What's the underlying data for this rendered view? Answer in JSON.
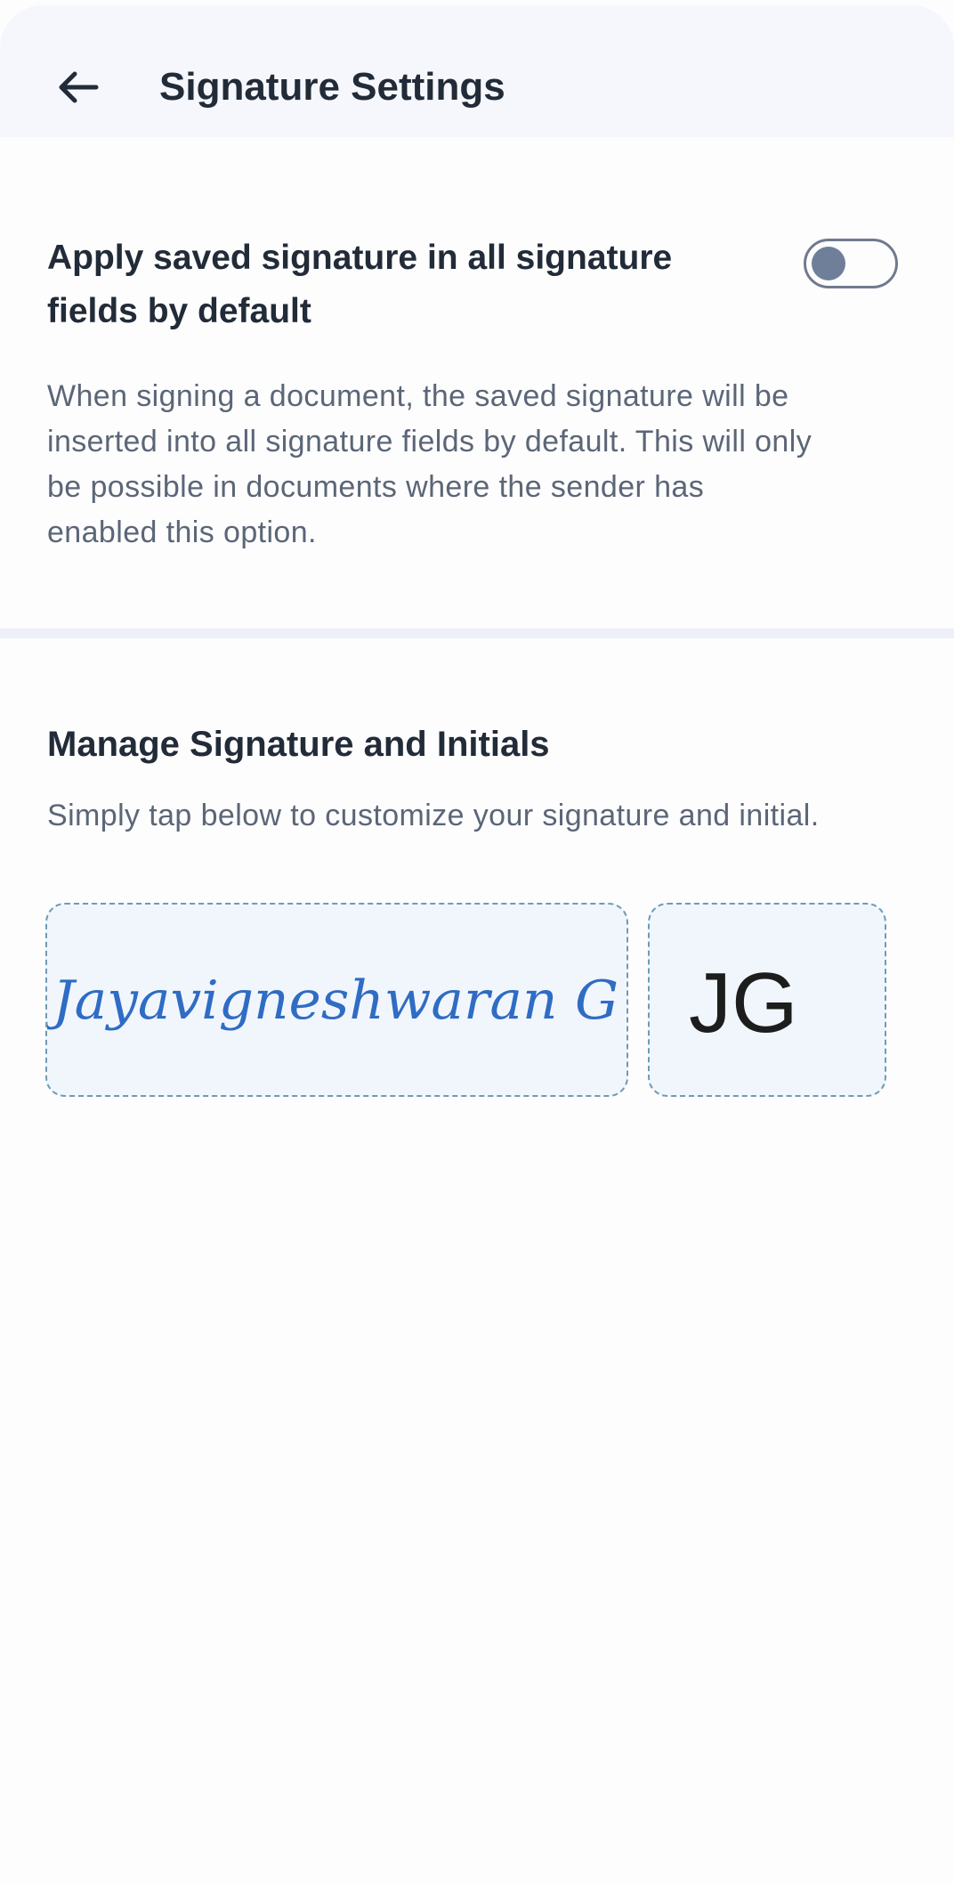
{
  "header": {
    "back_icon": "arrow-left-icon",
    "title": "Signature Settings"
  },
  "default_signature": {
    "title": "Apply saved signature in all signature fields by default",
    "toggle_on": false,
    "description": "When signing a document, the saved signature will be inserted into all signature fields by default. This will only be possible in documents where the sender has enabled this option."
  },
  "manage": {
    "title": "Manage Signature and Initials",
    "description": "Simply tap below to customize your signature and initial.",
    "signature_text": "Jayavigneshwaran G",
    "initials_text": "JG"
  },
  "colors": {
    "signature_ink": "#2f6cc4",
    "initials_ink": "#1d1d1d",
    "toggle_off": "#6f7f99"
  }
}
